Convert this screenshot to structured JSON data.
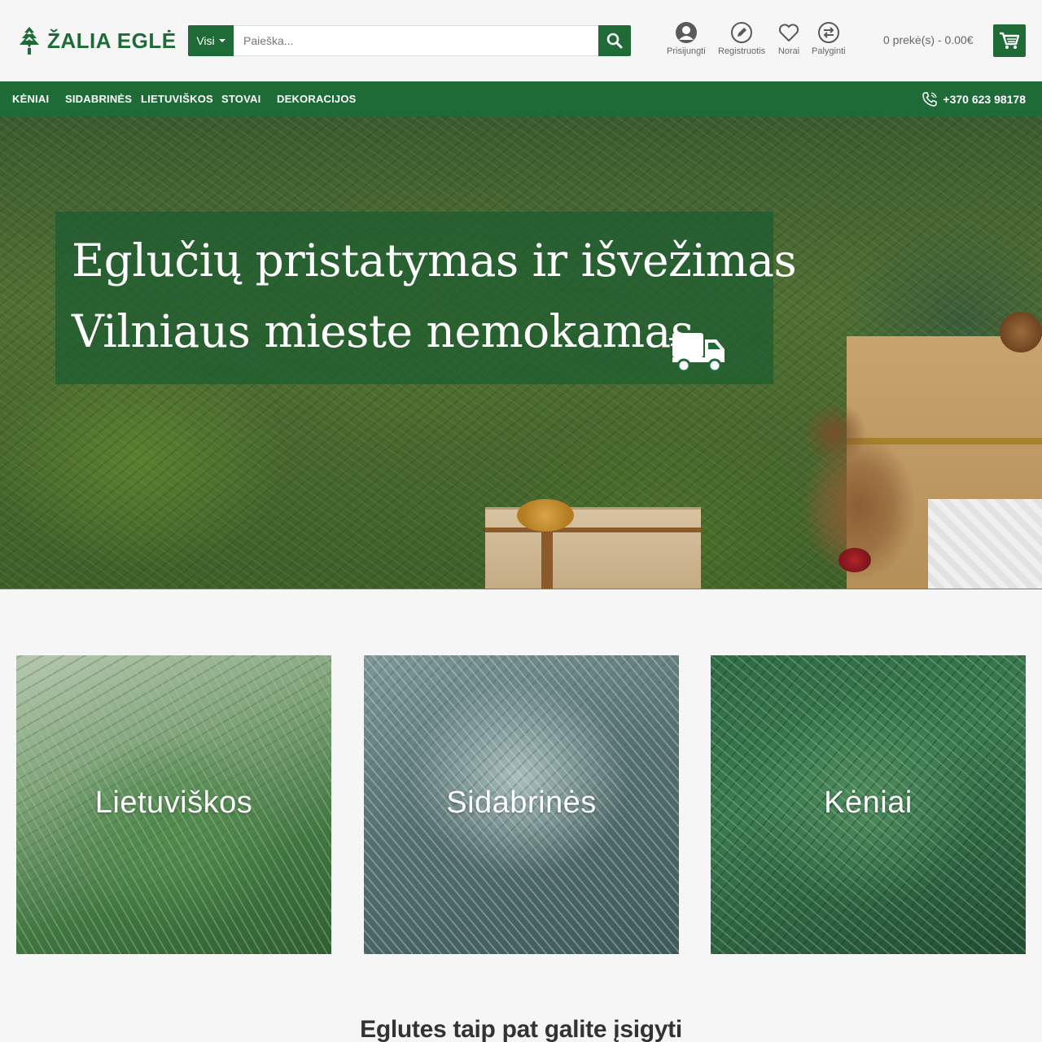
{
  "brand": {
    "name": "ŽALIA EGLĖ",
    "color": "#1e6b38"
  },
  "search": {
    "category_label": "Visi",
    "placeholder": "Paieška..."
  },
  "header_links": [
    {
      "label": "Prisijungti",
      "icon": "user-icon"
    },
    {
      "label": "Registruotis",
      "icon": "pencil-icon"
    },
    {
      "label": "Norai",
      "icon": "heart-icon"
    },
    {
      "label": "Palyginti",
      "icon": "compare-icon"
    }
  ],
  "cart": {
    "summary": "0 prekė(s) - 0.00€",
    "icon": "cart-icon"
  },
  "nav": {
    "items": [
      "Kėniai",
      "Sidabrinės",
      "Lietuviškos",
      "Stovai",
      "Dekoracijos"
    ],
    "phone": "+370 623 98178"
  },
  "hero": {
    "line1": "Eglučių pristatymas ir išvežimas",
    "line2": "Vilniaus mieste nemokamas",
    "icon": "truck-icon"
  },
  "categories": [
    {
      "label": "Lietuviškos"
    },
    {
      "label": "Sidabrinės"
    },
    {
      "label": "Kėniai"
    }
  ],
  "section_title": "Eglutes taip pat galite įsigyti"
}
